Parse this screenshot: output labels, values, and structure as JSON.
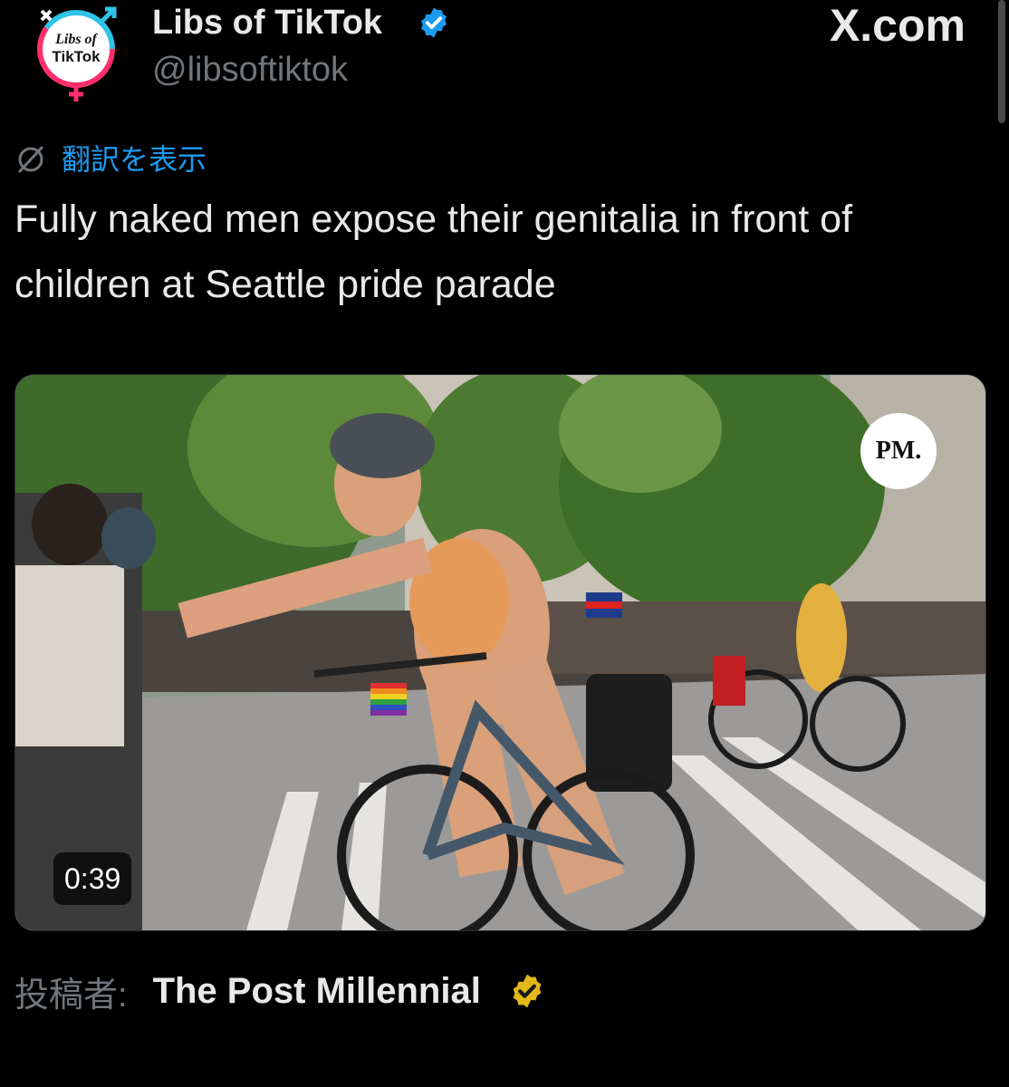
{
  "post": {
    "author": {
      "display_name": "Libs of TikTok",
      "handle": "@libsoftiktok",
      "avatar_text_line1": "Libs of",
      "avatar_text_line2": "TikTok",
      "verified": "blue-check-icon"
    },
    "site_brand": "X.com",
    "translate": {
      "icon": "globe-slash-icon",
      "label": "翻訳を表示"
    },
    "text_line1": "Fully naked men expose their genitalia in front of",
    "text_line2": "children at Seattle pride parade",
    "media": {
      "type": "video",
      "watermark": "PM.",
      "duration": "0:39"
    },
    "attribution": {
      "label": "投稿者:",
      "source_name": "The Post Millennial",
      "verified": "gold-check-icon"
    }
  },
  "colors": {
    "background": "#000000",
    "text": "#e7e9ea",
    "secondary": "#71767b",
    "link": "#1d9bf0",
    "verified_blue": "#1d9bf0",
    "verified_gold": "#e2b719"
  }
}
